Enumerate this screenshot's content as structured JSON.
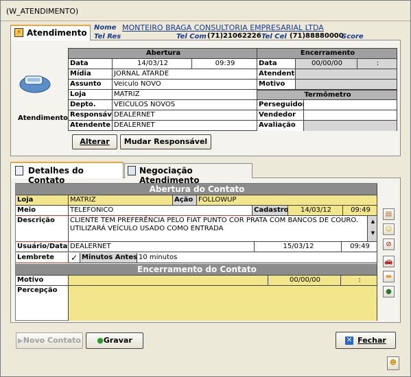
{
  "window": {
    "title": "(W_ATENDIMENTO)"
  },
  "tabs_top": {
    "atendimento": "Atendimento"
  },
  "header": {
    "nome_label": "Nome",
    "nome_value": "MONTEIRO BRAGA CONSULTORIA EMPRESARIAL LTDA",
    "telres_label": "Tel Res",
    "telcom_label": "Tel Com",
    "telcom_value": "(71)21062226",
    "telcel_label": "Tel Cel",
    "telcel_value": "(71)88880000",
    "score_label": "Score"
  },
  "side": {
    "label": "Atendimento"
  },
  "abertura": {
    "title": "Abertura",
    "data_label": "Data",
    "data_value": "14/03/12",
    "hora_value": "09:39",
    "midia_label": "Mídia",
    "midia_value": "JORNAL ATARDE",
    "assunto_label": "Assunto",
    "assunto_value": "Veiculo NOVO",
    "loja_label": "Loja",
    "loja_value": "MATRIZ",
    "depto_label": "Depto.",
    "depto_value": "VEICULOS NOVOS",
    "responsavel_label": "Responsável",
    "responsavel_value": "DEALERNET",
    "atendente_label": "Atendente",
    "atendente_value": "DEALERNET"
  },
  "encerramento": {
    "title": "Encerramento",
    "data_label": "Data",
    "data_value": "00/00/00",
    "hora_value": ":",
    "atendente_label": "Atendente",
    "motivo_label": "Motivo",
    "termometro_title": "Termômetro",
    "perseguidor_label": "Perseguidor",
    "vendedor_label": "Vendedor",
    "avaliacao_label": "Avaliação"
  },
  "buttons_top": {
    "alterar": "Alterar",
    "mudar": "Mudar Responsável"
  },
  "tabs_bottom": {
    "detalhes": "Detalhes do Contato",
    "negociacao": "Negociação Atendimento"
  },
  "contato": {
    "abertura_title": "Abertura do Contato",
    "loja_label": "Loja",
    "loja_value": "MATRIZ",
    "acao_label": "Ação",
    "acao_value": "FOLLOWUP",
    "meio_label": "Meio",
    "meio_value": "TELEFONICO",
    "cadastro_label": "Cadastro",
    "cadastro_date": "14/03/12",
    "cadastro_time": "09:49",
    "descricao_label": "Descrição",
    "descricao_value": "CLIENTE TEM PREFERÊNCIA PELO FIAT PUNTO COR PRATA COM BANCOS DE COURO. UTILIZARÁ VEÍCULO USADO COMO ENTRADA",
    "usuario_label": "Usuário/Data",
    "usuario_value": "DEALERNET",
    "usuario_date": "15/03/12",
    "usuario_time": "09:49",
    "lembrete_label": "Lembrete",
    "check": "✓",
    "minutos_label": "Minutos Antes",
    "minutos_value": "10 minutos",
    "encerramento_title": "Encerramento do Contato",
    "motivo_label": "Motivo",
    "motivo_date": "00/00/00",
    "motivo_time": ":",
    "percepcao_label": "Percepção"
  },
  "buttons_bottom": {
    "novo": "Novo Contato",
    "gravar": "Gravar",
    "fechar": "Fechar"
  }
}
